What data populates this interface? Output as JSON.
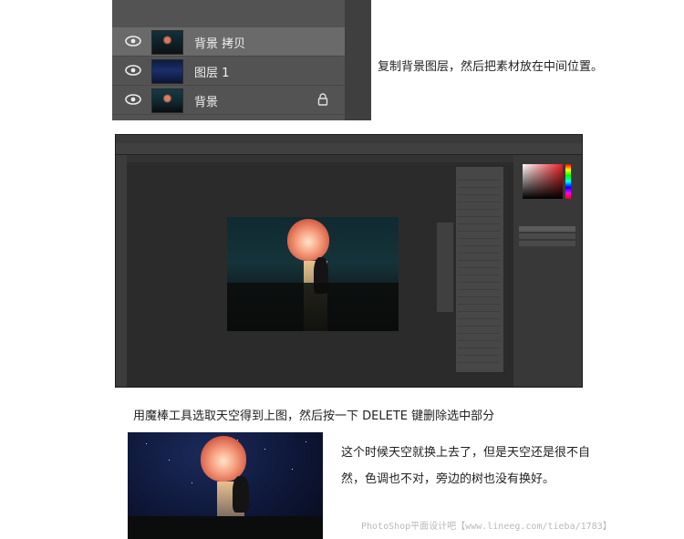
{
  "layers_panel": {
    "layers": [
      {
        "name": "背景 拷贝",
        "selected": true,
        "visible": true,
        "locked": false
      },
      {
        "name": "图层 1",
        "selected": false,
        "visible": true,
        "locked": false
      },
      {
        "name": "背景",
        "selected": false,
        "visible": true,
        "locked": true
      }
    ]
  },
  "captions": {
    "step1": "复制背景图层，然后把素材放在中间位置。",
    "step2": "用魔棒工具选取天空得到上图，然后按一下 DELETE 键删除选中部分",
    "step3_line1": "这个时候天空就换上去了，但是天空还是很不自",
    "step3_line2": "然，色调也不对，旁边的树也没有换好。"
  },
  "watermark": "PhotoShop平面设计吧【www.lineeg.com/tieba/1783】",
  "colors": {
    "panel_bg": "#535353",
    "selected_row": "#6a6a6a",
    "ps_workspace": "#2b2b2b",
    "foreground_color_picker": "#e61f24"
  },
  "icons": [
    "eye-icon",
    "lock-icon"
  ]
}
